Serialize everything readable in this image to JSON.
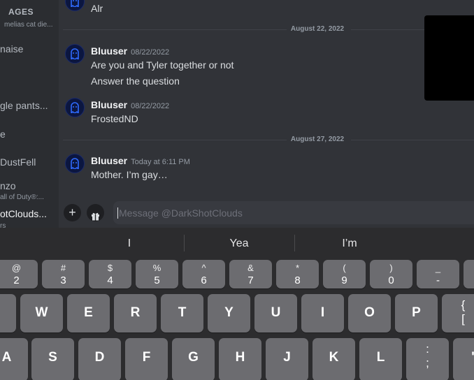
{
  "sidebar": {
    "header": "AGES",
    "items": [
      {
        "label": "melias cat die...",
        "small": true
      },
      {
        "label": "naise"
      },
      {
        "label": "gle pants..."
      },
      {
        "label": "e"
      },
      {
        "label": "DustFell"
      },
      {
        "label": "nzo"
      },
      {
        "label": "all of Duty®:...",
        "small": true
      },
      {
        "label": "otClouds..."
      },
      {
        "label": "rs",
        "small": true
      }
    ]
  },
  "chat": {
    "top_partial_message": "Alr",
    "dividers": [
      "August 22, 2022",
      "August 27, 2022"
    ],
    "messages": [
      {
        "username": "Bluuser",
        "timestamp": "08/22/2022",
        "lines": [
          "Are you and Tyler together or not",
          "Answer the question"
        ]
      },
      {
        "username": "Bluuser",
        "timestamp": "08/22/2022",
        "lines": [
          "FrostedND"
        ]
      },
      {
        "username": "Bluuser",
        "timestamp": "Today at 6:11 PM",
        "lines": [
          "Mother. I’m gay…"
        ]
      }
    ]
  },
  "composer": {
    "plus_icon": "+",
    "gift_icon": "gift-icon",
    "placeholder": "Message @DarkShotClouds"
  },
  "keyboard": {
    "suggestions": [
      "I",
      "Yea",
      "I’m"
    ],
    "row1": [
      {
        "top": "",
        "bottom": ""
      },
      {
        "top": "@",
        "bottom": "2"
      },
      {
        "top": "#",
        "bottom": "3"
      },
      {
        "top": "$",
        "bottom": "4"
      },
      {
        "top": "%",
        "bottom": "5"
      },
      {
        "top": "^",
        "bottom": "6"
      },
      {
        "top": "&",
        "bottom": "7"
      },
      {
        "top": "*",
        "bottom": "8"
      },
      {
        "top": "(",
        "bottom": "9"
      },
      {
        "top": ")",
        "bottom": "0"
      },
      {
        "top": "_",
        "bottom": "-"
      },
      {
        "top": "",
        "bottom": ""
      }
    ],
    "row2": [
      "",
      "W",
      "E",
      "R",
      "T",
      "Y",
      "U",
      "I",
      "O",
      "P",
      "{ ["
    ],
    "row3": [
      "A",
      "S",
      "D",
      "F",
      "G",
      "H",
      "J",
      "K",
      "L",
      ":;",
      "\""
    ]
  },
  "colors": {
    "chat_bg": "#313338",
    "sidebar_bg": "#2b2d31",
    "keyboard_bg": "#2c2c2e",
    "key_bg": "#6c6c70",
    "username": "#f2f3f5"
  }
}
